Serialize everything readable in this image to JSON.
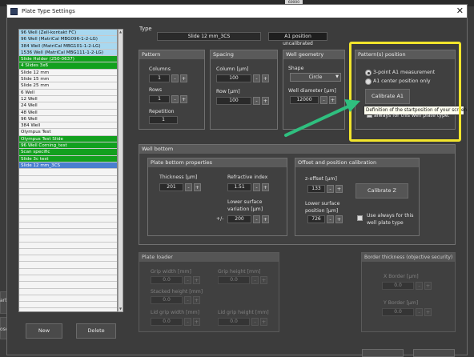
{
  "window": {
    "title": "Plate Type Settings",
    "close": "✕"
  },
  "background": {
    "top_right_value": "60000",
    "left_labels": [
      "art",
      "ose"
    ]
  },
  "plate_list": {
    "items": [
      {
        "label": "96 Well (Zell-kontakt FC)",
        "color": "#a8d8f0"
      },
      {
        "label": "96 Well (MatriCal MBG096-1-2-LG)",
        "color": "#a8d8f0"
      },
      {
        "label": "384 Well (MatriCal MBG101-1-2-LG)",
        "color": "#a8d8f0"
      },
      {
        "label": "1536 Well (MatriCal MBG111-1-2-LG)",
        "color": "#a8d8f0"
      },
      {
        "label": "Slide Holder (250-0637)",
        "color": "#12a01e"
      },
      {
        "label": "4 Slides 3x6",
        "color": "#12a01e"
      },
      {
        "label": "Slide 12 mm",
        "color": "#f4f4f4"
      },
      {
        "label": "Slide 15 mm",
        "color": "#f4f4f4"
      },
      {
        "label": "Slide 25 mm",
        "color": "#f4f4f4"
      },
      {
        "label": "6   Well",
        "color": "#f4f4f4"
      },
      {
        "label": "12  Well",
        "color": "#f4f4f4"
      },
      {
        "label": "24  Well",
        "color": "#f4f4f4"
      },
      {
        "label": "48  Well",
        "color": "#f4f4f4"
      },
      {
        "label": "96  Well",
        "color": "#f4f4f4"
      },
      {
        "label": "384 Well",
        "color": "#f4f4f4"
      },
      {
        "label": "Olympus Test",
        "color": "#f4f4f4"
      },
      {
        "label": "Olympus Test Slide",
        "color": "#12a01e"
      },
      {
        "label": "96  Well Corning_test",
        "color": "#12a01e"
      },
      {
        "label": "Scan specific",
        "color": "#12a01e"
      },
      {
        "label": "Slide 3c test",
        "color": "#12a01e"
      },
      {
        "label": "Slide 12 mm_3CS",
        "color": "#4a7fd0"
      }
    ],
    "new_label": "New",
    "delete_label": "Delete"
  },
  "type": {
    "label": "Type",
    "value": "Slide 12 mm_3CS",
    "a1_status": "A1 position uncalibrated"
  },
  "pattern": {
    "title": "Pattern",
    "columns_label": "Columns",
    "columns_value": "1",
    "rows_label": "Rows",
    "rows_value": "1",
    "repetition_label": "Repetition",
    "repetition_value": "1"
  },
  "spacing": {
    "title": "Spacing",
    "column_label": "Column [µm]",
    "column_value": "100",
    "row_label": "Row [µm]",
    "row_value": "100"
  },
  "well_geometry": {
    "title": "Well geometry",
    "shape_label": "Shape",
    "shape_value": "Circle",
    "diameter_label": "Well diameter [µm]",
    "diameter_value": "12000"
  },
  "patterns_position": {
    "title": "Pattern(s) position",
    "option1": "3-point A1 measurement",
    "option2": "A1 center position only",
    "calibrate_a1": "Calibrate A1",
    "tooltip_line1": "Definition of the startposition of your screen",
    "tooltip_line2": "always for this well plate type."
  },
  "well_bottom": {
    "title": "Well bottom",
    "properties": {
      "title": "Plate bottom properties",
      "thickness_label": "Thickness [µm]",
      "thickness_value": "201",
      "refractive_label": "Refractive index",
      "refractive_value": "1.51",
      "lower_var_label1": "Lower surface",
      "lower_var_label2": "variation [µm]",
      "plusminus": "+/-",
      "lower_var_value": "200"
    },
    "offset": {
      "title": "Offset and position calibration",
      "z_offset_label": "z-offset [µm]",
      "z_offset_value": "133",
      "calibrate_z": "Calibrate Z",
      "lower_pos_label1": "Lower surface",
      "lower_pos_label2": "position [µm]",
      "lower_pos_value": "726",
      "use_always1": "Use always for this",
      "use_always2": "well plate type"
    }
  },
  "plate_loader": {
    "title": "Plate loader",
    "grip_width_label": "Grip width [mm]",
    "grip_width_value": "0.0",
    "grip_height_label": "Grip height [mm]",
    "grip_height_value": "0.0",
    "stacked_height_label": "Stacked height [mm]",
    "stacked_height_value": "0.0",
    "lid_grip_width_label": "Lid grip width [mm]",
    "lid_grip_width_value": "0.0",
    "lid_grip_height_label": "Lid grip height [mm]",
    "lid_grip_height_value": "0.0"
  },
  "border": {
    "title": "Border thickness (objective security)",
    "x_label": "X Border [µm]",
    "x_value": "0.0",
    "y_label": "Y Border [µm]",
    "y_value": "0.0"
  },
  "spin": {
    "minus": "-",
    "plus": "+"
  },
  "colors": {
    "highlight": "#f2e52c",
    "arrow": "#2fbf7f"
  }
}
